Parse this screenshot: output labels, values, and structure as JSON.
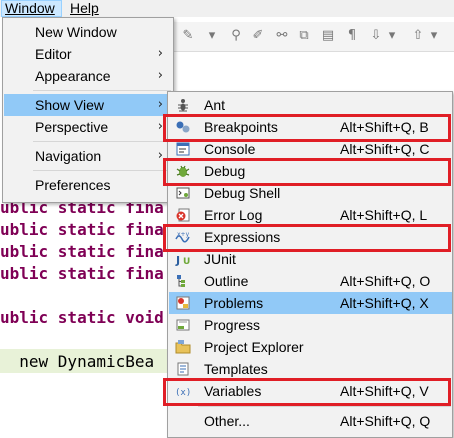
{
  "menubar": {
    "window": "Window",
    "help": "Help"
  },
  "editor": {
    "code_lines": [
      "ublic static fina",
      "ublic static fina",
      "ublic static fina",
      "ublic static fina",
      "ublic static void",
      "  new DynamicBea"
    ]
  },
  "window_menu": {
    "items": [
      {
        "label": "New Window"
      },
      {
        "label": "Editor"
      },
      {
        "label": "Appearance"
      },
      {
        "label": "Show View"
      },
      {
        "label": "Perspective"
      },
      {
        "label": "Navigation"
      },
      {
        "label": "Preferences"
      }
    ]
  },
  "show_view_menu": {
    "items": [
      {
        "label": "Ant",
        "shortcut": "",
        "icon": "ant-icon",
        "highlighted": false
      },
      {
        "label": "Breakpoints",
        "shortcut": "Alt+Shift+Q, B",
        "icon": "breakpoints-icon",
        "highlighted": true
      },
      {
        "label": "Console",
        "shortcut": "Alt+Shift+Q, C",
        "icon": "console-icon",
        "highlighted": false
      },
      {
        "label": "Debug",
        "shortcut": "",
        "icon": "debug-icon",
        "highlighted": true
      },
      {
        "label": "Debug Shell",
        "shortcut": "",
        "icon": "debug-shell-icon",
        "highlighted": false
      },
      {
        "label": "Error Log",
        "shortcut": "Alt+Shift+Q, L",
        "icon": "error-log-icon",
        "highlighted": false
      },
      {
        "label": "Expressions",
        "shortcut": "",
        "icon": "expressions-icon",
        "highlighted": true
      },
      {
        "label": "JUnit",
        "shortcut": "",
        "icon": "junit-icon",
        "highlighted": false
      },
      {
        "label": "Outline",
        "shortcut": "Alt+Shift+Q, O",
        "icon": "outline-icon",
        "highlighted": false
      },
      {
        "label": "Problems",
        "shortcut": "Alt+Shift+Q, X",
        "icon": "problems-icon",
        "highlighted": false
      },
      {
        "label": "Progress",
        "shortcut": "",
        "icon": "progress-icon",
        "highlighted": false
      },
      {
        "label": "Project Explorer",
        "shortcut": "",
        "icon": "project-explorer-icon",
        "highlighted": false
      },
      {
        "label": "Templates",
        "shortcut": "",
        "icon": "templates-icon",
        "highlighted": false
      },
      {
        "label": "Variables",
        "shortcut": "Alt+Shift+Q, V",
        "icon": "variables-icon",
        "highlighted": true
      },
      {
        "label": "Other...",
        "shortcut": "Alt+Shift+Q, Q",
        "icon": "",
        "highlighted": false
      }
    ]
  },
  "colors": {
    "menu_hover": "#91c9f7",
    "highlight_box": "#e01e26",
    "keyword": "#7f0055"
  }
}
